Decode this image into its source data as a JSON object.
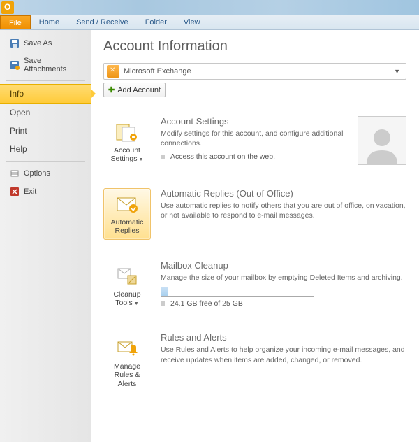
{
  "ribbon": {
    "file": "File",
    "tabs": [
      "Home",
      "Send / Receive",
      "Folder",
      "View"
    ]
  },
  "sidebar": {
    "top": [
      {
        "label": "Save As",
        "icon": "save-icon"
      },
      {
        "label": "Save Attachments",
        "icon": "save-attach-icon"
      }
    ],
    "mid": [
      {
        "label": "Info",
        "selected": true
      },
      {
        "label": "Open"
      },
      {
        "label": "Print"
      },
      {
        "label": "Help"
      }
    ],
    "bottom": [
      {
        "label": "Options",
        "icon": "options-icon"
      },
      {
        "label": "Exit",
        "icon": "exit-icon"
      }
    ]
  },
  "page": {
    "title": "Account Information",
    "account_name": "Microsoft Exchange",
    "add_account": "Add Account"
  },
  "sections": {
    "settings": {
      "button": "Account Settings",
      "title": "Account Settings",
      "desc": "Modify settings for this account, and configure additional connections.",
      "bullet": "Access this account on the web."
    },
    "replies": {
      "button": "Automatic Replies",
      "title": "Automatic Replies (Out of Office)",
      "desc": "Use automatic replies to notify others that you are out of office, on vacation, or not available to respond to e-mail messages."
    },
    "cleanup": {
      "button": "Cleanup Tools",
      "title": "Mailbox Cleanup",
      "desc": "Manage the size of your mailbox by emptying Deleted Items and archiving.",
      "quota": "24.1 GB free of 25 GB",
      "quota_pct": 4
    },
    "rules": {
      "button": "Manage Rules & Alerts",
      "title": "Rules and Alerts",
      "desc": "Use Rules and Alerts to help organize your incoming e-mail messages, and receive updates when items are added, changed, or removed."
    }
  }
}
